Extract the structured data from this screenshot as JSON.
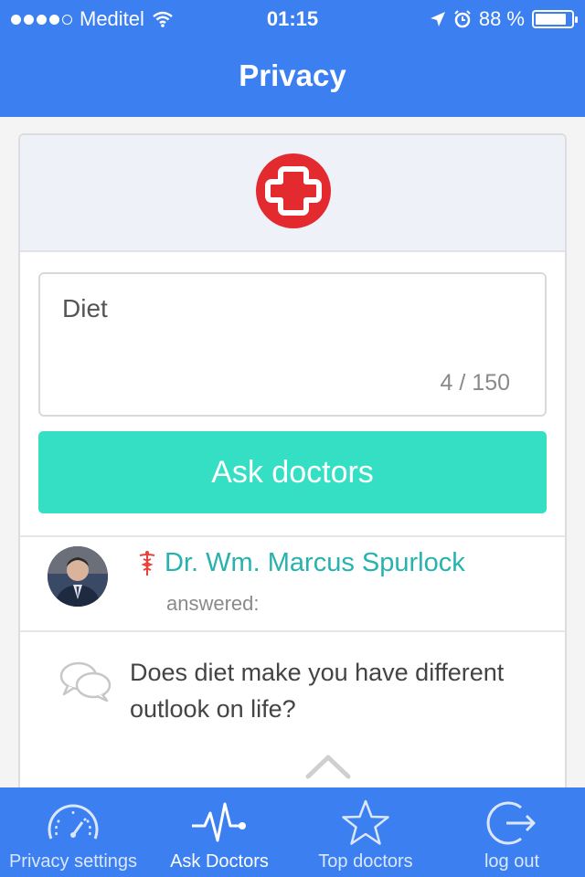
{
  "status_bar": {
    "carrier": "Meditel",
    "time": "01:15",
    "battery": "88 %",
    "battery_level": 0.88,
    "icons": [
      "signal-dots-icon",
      "wifi-icon",
      "location-arrow-icon",
      "alarm-icon",
      "battery-icon"
    ]
  },
  "header": {
    "title": "Privacy"
  },
  "question": {
    "value": "Diet",
    "char_count": "4 / 150",
    "submit_label": "Ask doctors"
  },
  "answer": {
    "doctor_name": "Dr. Wm. Marcus Spurlock",
    "answered_label": "answered:",
    "question_text": "Does diet make you have different outlook on life?"
  },
  "tabs": [
    {
      "label": "Privacy settings",
      "icon": "speedometer-icon",
      "active": false
    },
    {
      "label": "Ask Doctors",
      "icon": "heartbeat-icon",
      "active": true
    },
    {
      "label": "Top doctors",
      "icon": "star-icon",
      "active": false
    },
    {
      "label": "log out",
      "icon": "logout-icon",
      "active": false
    }
  ],
  "colors": {
    "primary": "#3b7ff0",
    "accent": "#35dfc4",
    "doctor_name": "#27b3ad",
    "logo": "#e22a2f"
  }
}
